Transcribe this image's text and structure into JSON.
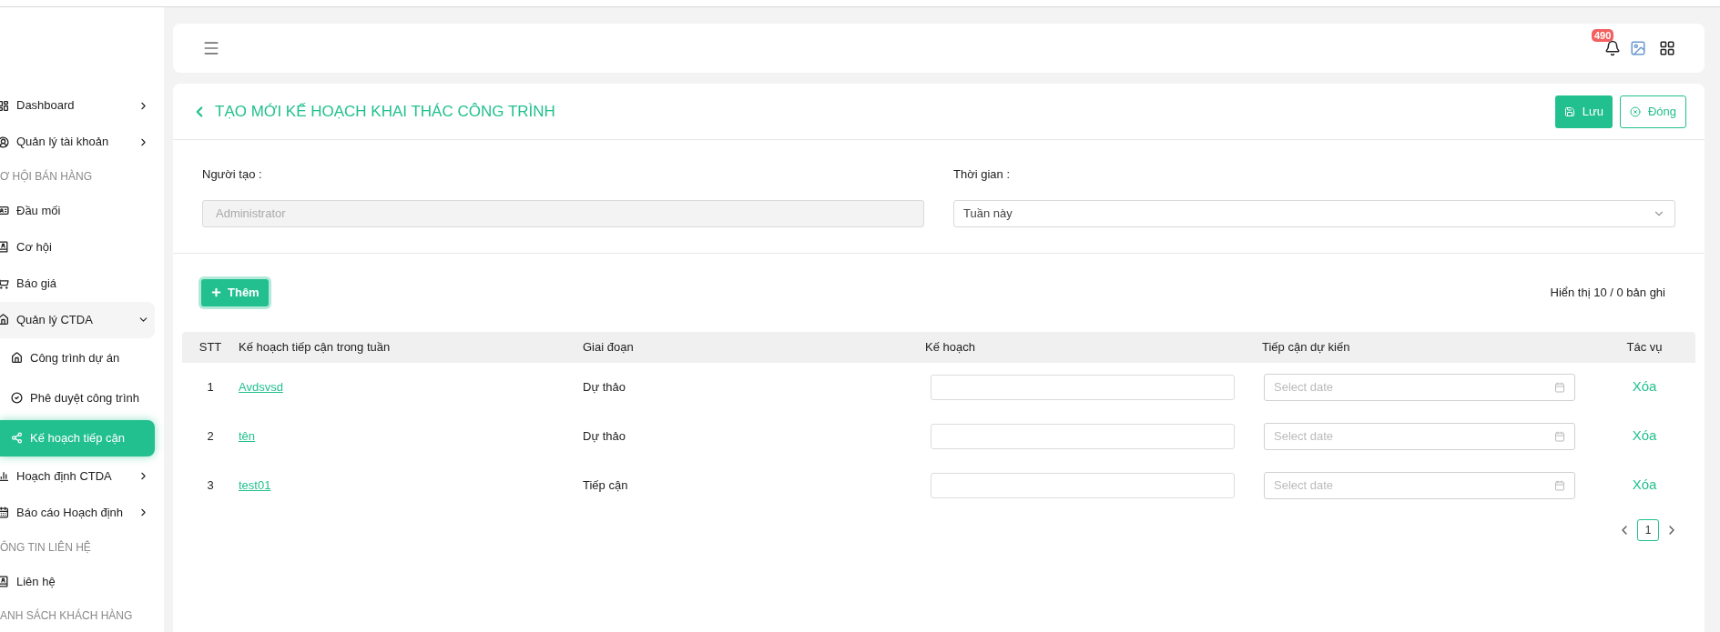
{
  "sidebar": {
    "items": [
      {
        "kind": "item",
        "label": "Dashboard",
        "selected": false,
        "expanded": false
      },
      {
        "kind": "item",
        "label": "Quản lý tài khoản",
        "selected": false,
        "expanded": false
      },
      {
        "kind": "section",
        "label": "Ơ HỘI BÁN HÀNG"
      },
      {
        "kind": "item",
        "label": "Đầu mối",
        "selected": false
      },
      {
        "kind": "item",
        "label": "Cơ hội",
        "selected": false
      },
      {
        "kind": "item",
        "label": "Báo giá",
        "selected": false
      },
      {
        "kind": "item",
        "label": "Quản lý CTDA",
        "selected": false,
        "expanded": true,
        "children": [
          {
            "label": "Công trình dự án",
            "selected": false
          },
          {
            "label": "Phê duyệt công trình",
            "selected": false
          },
          {
            "label": "Kế hoạch tiếp cận",
            "selected": true
          }
        ]
      },
      {
        "kind": "item",
        "label": "Hoạch định CTDA",
        "selected": false,
        "expanded": false
      },
      {
        "kind": "item",
        "label": "Báo cáo Hoạch định",
        "selected": false,
        "expanded": false
      },
      {
        "kind": "section",
        "label": "ÔNG TIN LIÊN HỆ"
      },
      {
        "kind": "item",
        "label": "Liên hệ",
        "selected": false
      },
      {
        "kind": "section",
        "label": "ANH SÁCH KHÁCH HÀNG"
      }
    ]
  },
  "header": {
    "notification_count": "490"
  },
  "page": {
    "title": "TẠO MỚI KẾ HOẠCH KHAI THÁC CÔNG TRÌNH",
    "buttons": [
      {
        "label": "Lưu",
        "kind": "primary"
      },
      {
        "label": "Đóng",
        "kind": "outline"
      }
    ],
    "fields": [
      {
        "label": "Người tạo :",
        "value": "Administrator",
        "kind": "text"
      },
      {
        "label": "Thời gian :",
        "value": "Tuần này",
        "kind": "select"
      }
    ],
    "add_button": "Thêm",
    "record_count": "Hiển thị 10 / 0 bản ghi"
  },
  "table": {
    "columns": [
      "STT",
      "Kế hoạch tiếp cận trong tuần",
      "Giai đoạn",
      "Kế hoạch",
      "Tiếp cận dự kiến",
      "Tác vụ"
    ],
    "rows": [
      {
        "stt": "1",
        "name": "Avdsvsd",
        "stage": "Dự thảo",
        "date_placeholder": "Select date",
        "action": "Xóa"
      },
      {
        "stt": "2",
        "name": "tên",
        "stage": "Dự thảo",
        "date_placeholder": "Select date",
        "action": "Xóa"
      },
      {
        "stt": "3",
        "name": "test01",
        "stage": "Tiếp cận",
        "date_placeholder": "Select date",
        "action": "Xóa"
      }
    ]
  },
  "pagination": {
    "pages": [
      {
        "label": "1",
        "selected": true
      }
    ]
  }
}
